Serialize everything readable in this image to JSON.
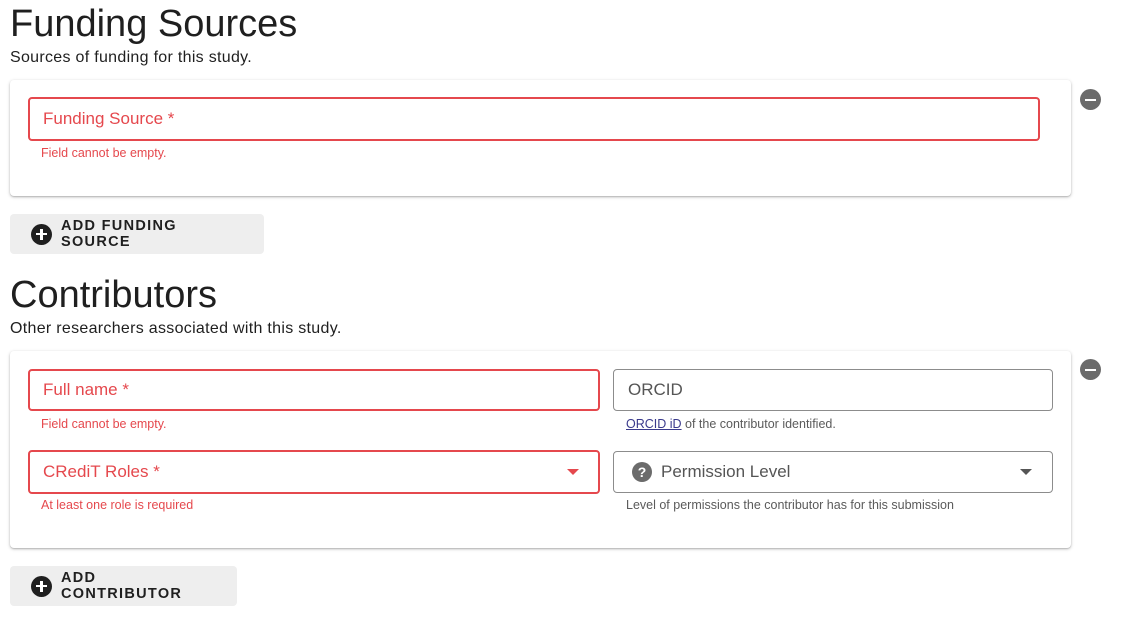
{
  "funding": {
    "title": "Funding Sources",
    "subtitle": "Sources of funding for this study.",
    "field_label": "Funding Source *",
    "field_error": "Field cannot be empty.",
    "add_label": "ADD FUNDING SOURCE"
  },
  "contributors": {
    "title": "Contributors",
    "subtitle": "Other researchers associated with this study.",
    "fullname_label": "Full name *",
    "fullname_error": "Field cannot be empty.",
    "orcid_label": "ORCID",
    "orcid_helper_link": "ORCID iD",
    "orcid_helper_rest": " of the contributor identified.",
    "roles_label": "CRediT Roles *",
    "roles_error": "At least one role is required",
    "permission_label": "Permission Level",
    "permission_helper": "Level of permissions the contributor has for this submission",
    "add_label": "ADD CONTRIBUTOR"
  },
  "colors": {
    "error": "#e5484d",
    "icon_grey": "#6b6b6b",
    "button_bg": "#eeeeee"
  },
  "icons": {
    "remove": "minus-circle-icon",
    "add": "plus-circle-icon",
    "help": "help-circle-icon",
    "dropdown": "arrow-drop-down-icon"
  }
}
